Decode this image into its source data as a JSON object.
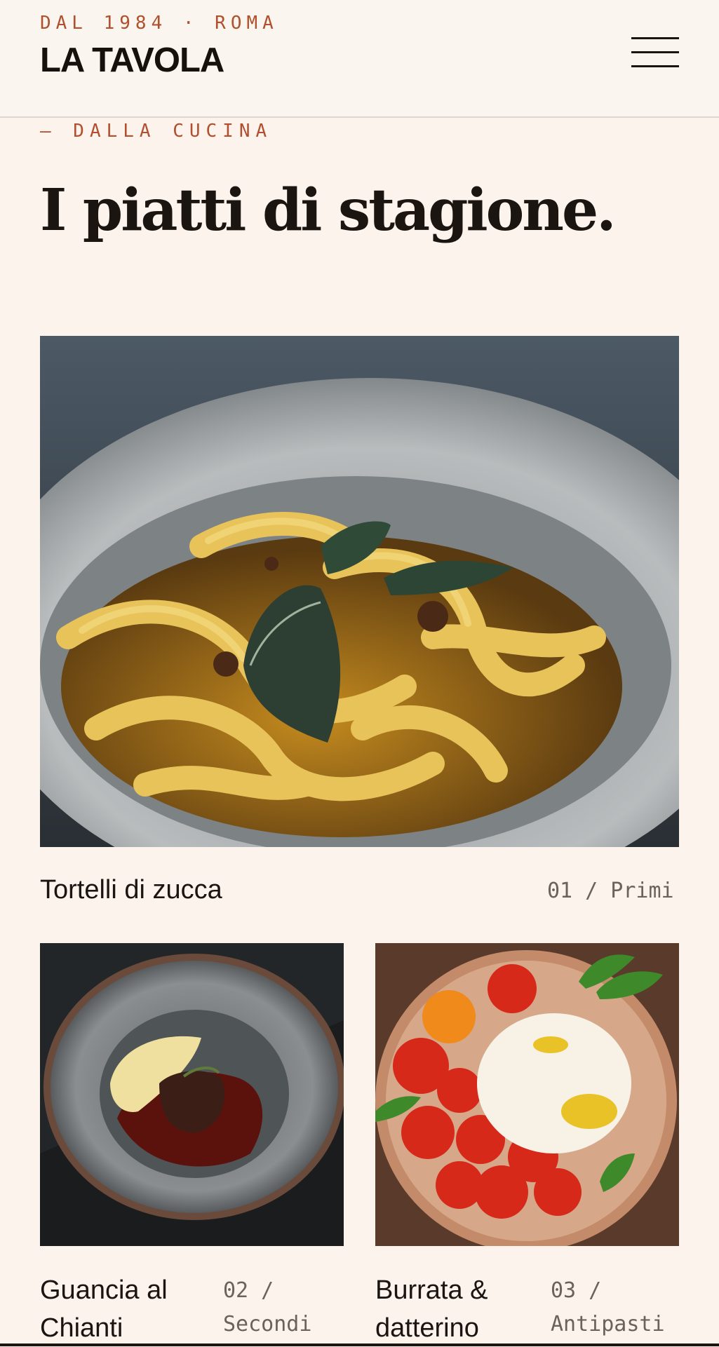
{
  "header": {
    "tagline": "DAL 1984 · ROMA",
    "brand": "LA TAVOLA",
    "menu_icon": "hamburger-menu-icon"
  },
  "section": {
    "eyebrow": "— DALLA CUCINA",
    "title": "I piatti di stagione."
  },
  "dishes": [
    {
      "name": "Tortelli di zucca",
      "index": "01",
      "category": "Primi",
      "meta": "01 / Primi"
    },
    {
      "name": "Guancia al Chianti",
      "index": "02",
      "category": "Secondi",
      "meta": "02 / Secondi"
    },
    {
      "name": "Burrata & datterino",
      "index": "03",
      "category": "Antipasti",
      "meta": "03 / Antipasti"
    }
  ],
  "colors": {
    "background": "#fcf3ed",
    "header_background": "#faf5ee",
    "accent": "#b0502f",
    "text": "#1b1512",
    "muted": "#6c625b"
  }
}
